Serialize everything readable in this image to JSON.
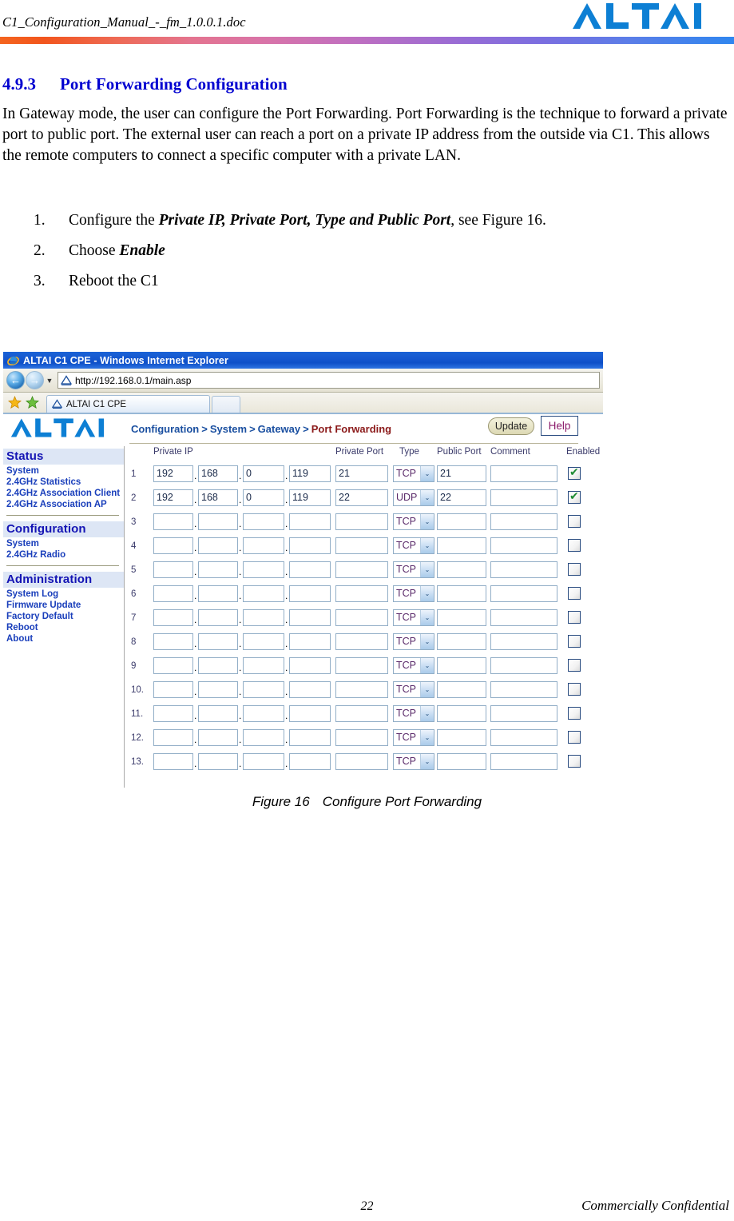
{
  "document": {
    "header_filename": "C1_Configuration_Manual_-_fm_1.0.0.1.doc",
    "brand": "ALTAI",
    "section_number": "4.9.3",
    "section_title": "Port Forwarding Configuration",
    "paragraph": "In Gateway mode, the user can configure the Port Forwarding. Port Forwarding is the technique to forward a private port to public port. The external user can reach a port on a private IP address from the outside via C1. This allows the remote computers to connect a specific computer with a private LAN.",
    "steps": [
      {
        "num": "1.",
        "pre": "Configure the ",
        "emphasis": "Private IP, Private Port, Type and Public Port",
        "post": ", see Figure 16."
      },
      {
        "num": "2.",
        "pre": "Choose ",
        "emphasis": "Enable",
        "post": ""
      },
      {
        "num": "3.",
        "pre": "Reboot the C1",
        "emphasis": "",
        "post": ""
      }
    ],
    "figure_caption_label": "Figure 16",
    "figure_caption_text": "Configure Port Forwarding",
    "footer_page_number": "22",
    "footer_confidential": "Commercially Confidential"
  },
  "browser": {
    "window_title": "ALTAI C1 CPE - Windows Internet Explorer",
    "address": "http://192.168.0.1/main.asp",
    "tab_label": "ALTAI C1 CPE",
    "back_glyph": "←",
    "forward_glyph": "→",
    "dropdown_glyph": "▼"
  },
  "webpage": {
    "logo_text": "ALTAI",
    "breadcrumb": {
      "items": [
        "Configuration",
        "System",
        "Gateway"
      ],
      "separator": ">",
      "current": "Port Forwarding"
    },
    "buttons": {
      "update_label": "Update",
      "help_label": "Help"
    },
    "sidebar": {
      "groups": [
        {
          "title": "Status",
          "items": [
            "System",
            "2.4GHz Statistics",
            "2.4GHz Association Client",
            "2.4GHz Association AP"
          ]
        },
        {
          "title": "Configuration",
          "items": [
            "System",
            "2.4GHz Radio"
          ]
        },
        {
          "title": "Administration",
          "items": [
            "System Log",
            "Firmware Update",
            "Factory Default",
            "Reboot",
            "About"
          ]
        }
      ]
    },
    "table": {
      "headers": {
        "private_ip": "Private IP",
        "private_port": "Private Port",
        "type": "Type",
        "public_port": "Public Port",
        "comment": "Comment",
        "enabled": "Enabled"
      },
      "select_arrow": "⌄",
      "ip_separator": ".",
      "rows": [
        {
          "num": "1",
          "ip": [
            "192",
            "168",
            "0",
            "119"
          ],
          "private_port": "21",
          "type": "TCP",
          "public_port": "21",
          "comment": "",
          "enabled": true
        },
        {
          "num": "2",
          "ip": [
            "192",
            "168",
            "0",
            "119"
          ],
          "private_port": "22",
          "type": "UDP",
          "public_port": "22",
          "comment": "",
          "enabled": true
        },
        {
          "num": "3",
          "ip": [
            "",
            "",
            "",
            ""
          ],
          "private_port": "",
          "type": "TCP",
          "public_port": "",
          "comment": "",
          "enabled": false
        },
        {
          "num": "4",
          "ip": [
            "",
            "",
            "",
            ""
          ],
          "private_port": "",
          "type": "TCP",
          "public_port": "",
          "comment": "",
          "enabled": false
        },
        {
          "num": "5",
          "ip": [
            "",
            "",
            "",
            ""
          ],
          "private_port": "",
          "type": "TCP",
          "public_port": "",
          "comment": "",
          "enabled": false
        },
        {
          "num": "6",
          "ip": [
            "",
            "",
            "",
            ""
          ],
          "private_port": "",
          "type": "TCP",
          "public_port": "",
          "comment": "",
          "enabled": false
        },
        {
          "num": "7",
          "ip": [
            "",
            "",
            "",
            ""
          ],
          "private_port": "",
          "type": "TCP",
          "public_port": "",
          "comment": "",
          "enabled": false
        },
        {
          "num": "8",
          "ip": [
            "",
            "",
            "",
            ""
          ],
          "private_port": "",
          "type": "TCP",
          "public_port": "",
          "comment": "",
          "enabled": false
        },
        {
          "num": "9",
          "ip": [
            "",
            "",
            "",
            ""
          ],
          "private_port": "",
          "type": "TCP",
          "public_port": "",
          "comment": "",
          "enabled": false
        },
        {
          "num": "10.",
          "ip": [
            "",
            "",
            "",
            ""
          ],
          "private_port": "",
          "type": "TCP",
          "public_port": "",
          "comment": "",
          "enabled": false
        },
        {
          "num": "11.",
          "ip": [
            "",
            "",
            "",
            ""
          ],
          "private_port": "",
          "type": "TCP",
          "public_port": "",
          "comment": "",
          "enabled": false
        },
        {
          "num": "12.",
          "ip": [
            "",
            "",
            "",
            ""
          ],
          "private_port": "",
          "type": "TCP",
          "public_port": "",
          "comment": "",
          "enabled": false
        },
        {
          "num": "13.",
          "ip": [
            "",
            "",
            "",
            ""
          ],
          "private_port": "",
          "type": "TCP",
          "public_port": "",
          "comment": "",
          "enabled": false
        }
      ]
    }
  },
  "colors": {
    "brand_blue": "#0d7fd4",
    "heading_blue": "#0000d0",
    "breadcrumb_blue": "#1a4fa0",
    "breadcrumb_current": "#8b1a1a",
    "check_green": "#1f8b33"
  }
}
